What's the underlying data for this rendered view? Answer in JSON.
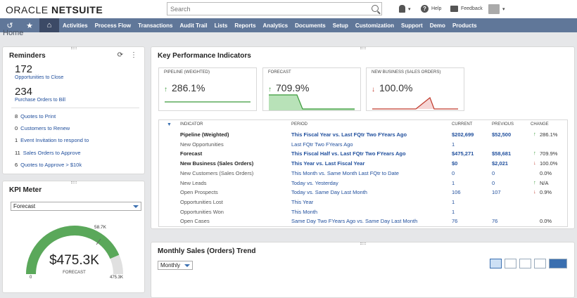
{
  "brand": {
    "oracle": "ORACLE ",
    "netsuite": "NETSUITE"
  },
  "search": {
    "placeholder": "Search"
  },
  "topbar": {
    "help": "Help",
    "feedback": "Feedback"
  },
  "nav": {
    "items": [
      "Activities",
      "Process Flow",
      "Transactions",
      "Audit Trail",
      "Lists",
      "Reports",
      "Analytics",
      "Documents",
      "Setup",
      "Customization",
      "Support",
      "Demo",
      "Products"
    ]
  },
  "page": {
    "title": "Home"
  },
  "reminders": {
    "title": "Reminders",
    "big": [
      {
        "count": "172",
        "label": "Opportunities to Close"
      },
      {
        "count": "234",
        "label": "Purchase Orders to Bill"
      }
    ],
    "items": [
      {
        "count": "8",
        "label": "Quotes to Print"
      },
      {
        "count": "0",
        "label": "Customers to Renew"
      },
      {
        "count": "1",
        "label": "Event Invitation to respond to"
      },
      {
        "count": "11",
        "label": "Sales Orders to Approve"
      },
      {
        "count": "6",
        "label": "Quotes to Approve > $10k"
      }
    ]
  },
  "kpimeter": {
    "title": "KPI Meter",
    "select": "Forecast",
    "value": "$475.3K",
    "label": "FORECAST",
    "min": "0",
    "max": "475.3K",
    "marker": "58.7K",
    "fill": 0.87,
    "color": "#5aa85a"
  },
  "kpi": {
    "title": "Key Performance Indicators",
    "cards": [
      {
        "title": "PIPELINE (WEIGHTED)",
        "value": "286.1%",
        "dir": "up"
      },
      {
        "title": "FORECAST",
        "value": "709.9%",
        "dir": "up"
      },
      {
        "title": "NEW BUSINESS (SALES ORDERS)",
        "value": "100.0%",
        "dir": "down"
      }
    ],
    "headers": {
      "indicator": "INDICATOR",
      "period": "PERIOD",
      "current": "CURRENT",
      "previous": "PREVIOUS",
      "change": "CHANGE"
    },
    "rows": [
      {
        "indicator": "Pipeline (Weighted)",
        "period": "This Fiscal Year vs. Last FQtr Two FYears Ago",
        "current": "$202,699",
        "previous": "$52,500",
        "change": "286.1%",
        "dir": "up",
        "bold": true
      },
      {
        "indicator": "New Opportunities",
        "period": "Last FQtr Two FYears Ago",
        "current": "1",
        "previous": "",
        "change": "",
        "dir": "",
        "bold": false
      },
      {
        "indicator": "Forecast",
        "period": "This Fiscal Half vs. Last FQtr Two FYears Ago",
        "current": "$475,271",
        "previous": "$58,681",
        "change": "709.9%",
        "dir": "up",
        "bold": true
      },
      {
        "indicator": "New Business (Sales Orders)",
        "period": "This Year vs. Last Fiscal Year",
        "current": "$0",
        "previous": "$2,021",
        "change": "100.0%",
        "dir": "down",
        "bold": true
      },
      {
        "indicator": "New Customers (Sales Orders)",
        "period": "This Month vs. Same Month Last FQtr to Date",
        "current": "0",
        "previous": "0",
        "change": "0.0%",
        "dir": "",
        "bold": false
      },
      {
        "indicator": "New Leads",
        "period": "Today vs. Yesterday",
        "current": "1",
        "previous": "0",
        "change": "N/A",
        "dir": "up",
        "bold": false
      },
      {
        "indicator": "Open Prospects",
        "period": "Today vs. Same Day Last Month",
        "current": "106",
        "previous": "107",
        "change": "0.9%",
        "dir": "down",
        "bold": false
      },
      {
        "indicator": "Opportunities Lost",
        "period": "This Year",
        "current": "1",
        "previous": "",
        "change": "",
        "dir": "",
        "bold": false
      },
      {
        "indicator": "Opportunities Won",
        "period": "This Month",
        "current": "1",
        "previous": "",
        "change": "",
        "dir": "",
        "bold": false
      },
      {
        "indicator": "Open Cases",
        "period": "Same Day Two FYears Ago vs. Same Day Last Month",
        "current": "76",
        "previous": "76",
        "change": "0.0%",
        "dir": "",
        "bold": false
      }
    ]
  },
  "trend": {
    "title": "Monthly Sales (Orders) Trend",
    "select": "Monthly"
  },
  "colors": {
    "up": "#3a9a3a",
    "down": "#c0392b",
    "nav": "#607799",
    "link": "#1f4e9c"
  }
}
